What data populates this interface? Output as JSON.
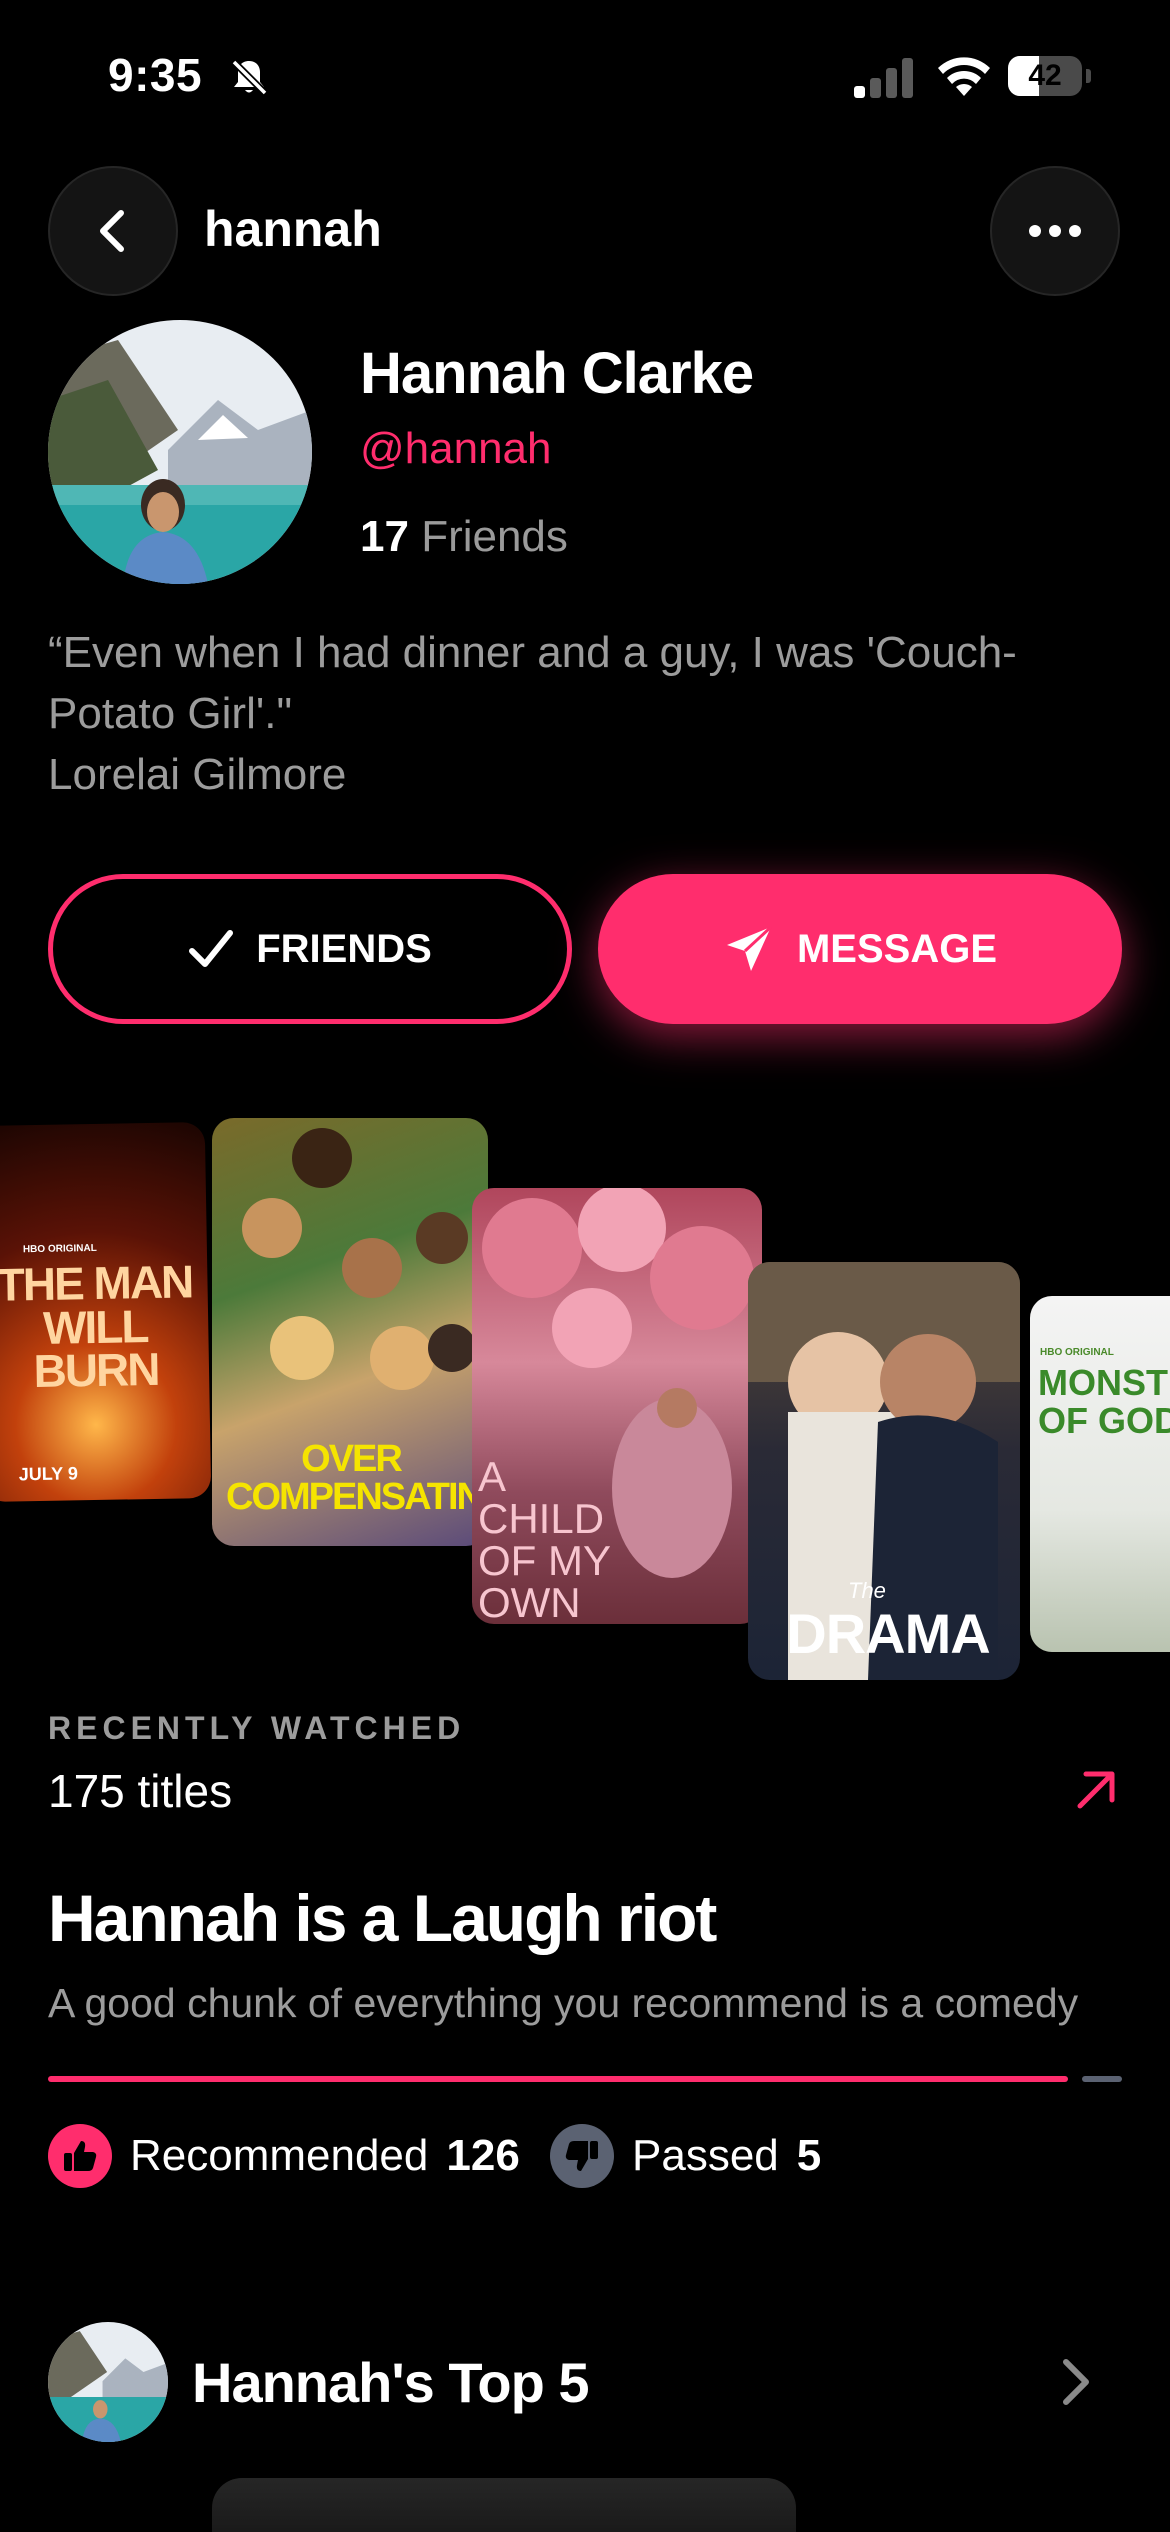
{
  "status_bar": {
    "time": "9:35",
    "battery_level": "42",
    "battery_fraction": 0.42,
    "icons": [
      "bell-slash-icon",
      "signal-icon",
      "wifi-icon",
      "battery-icon"
    ]
  },
  "header": {
    "username": "hannah",
    "back_icon": "chevron-left-icon",
    "more_icon": "ellipsis-icon"
  },
  "profile": {
    "name": "Hannah Clarke",
    "handle": "@hannah",
    "friends_count": "17",
    "friends_label": "Friends",
    "bio_lines": [
      "“Even when I had dinner and a guy, I was 'Couch-",
      "Potato Girl'.\"",
      "Lorelai Gilmore"
    ]
  },
  "actions": {
    "friends_label": "FRIENDS",
    "message_label": "MESSAGE"
  },
  "posters": [
    {
      "title": "THE MAN WILL BURN",
      "brand": "HBO ORIGINAL",
      "footer": "JULY 9"
    },
    {
      "title": "OVER COMPENSATING"
    },
    {
      "title": "A CHILD OF MY OWN"
    },
    {
      "title": "DRAMA",
      "prefix": "The"
    },
    {
      "title": "MONSTE OF GOD",
      "brand": "HBO ORIGINAL"
    }
  ],
  "recently_watched": {
    "label": "RECENTLY WATCHED",
    "count_text": "175 titles",
    "link_icon": "arrow-up-right-icon"
  },
  "insight": {
    "title": "Hannah is a Laugh riot",
    "subtitle": "A good chunk of everything you recommend is a comedy"
  },
  "ratio": {
    "recommended_label": "Recommended",
    "recommended_value": 126,
    "passed_label": "Passed",
    "passed_value": 5,
    "colors": {
      "recommended": "#ff2d6d",
      "passed": "#5b6272"
    }
  },
  "top5": {
    "title": "Hannah's Top 5",
    "chevron_icon": "chevron-right-icon"
  },
  "colors": {
    "accent": "#ff2d6d",
    "background": "#000000",
    "muted_text": "#9c9c9c"
  }
}
